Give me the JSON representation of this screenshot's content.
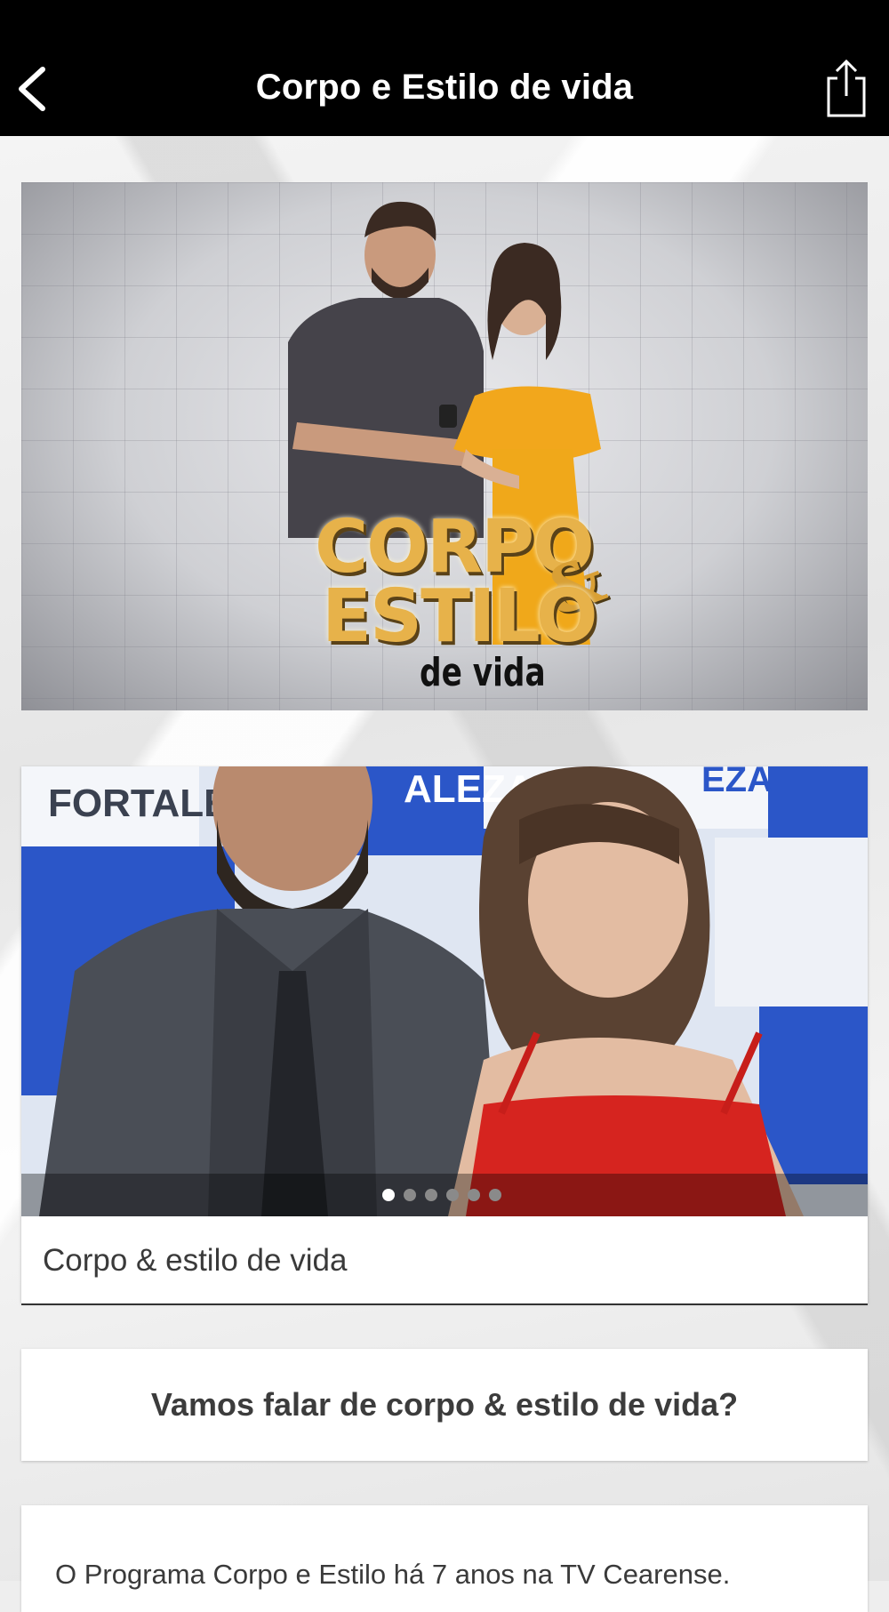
{
  "navbar": {
    "title": "Corpo e Estilo de vida",
    "back_icon": "chevron-left-icon",
    "share_icon": "share-icon"
  },
  "hero": {
    "logo_line1": "CORPO",
    "logo_amp": "&",
    "logo_line2": "ESTILO",
    "logo_line3": "de vida"
  },
  "slideshow": {
    "photo_text_left": "FORTALEZ",
    "photo_text_mid": "ALEZA",
    "photo_text_right": "EZA",
    "dots_total": 6,
    "active_index": 0,
    "caption": "Corpo & estilo de vida"
  },
  "heading_card": {
    "text": "Vamos falar de corpo & estilo de vida?"
  },
  "text_card": {
    "body": "O Programa Corpo e Estilo há 7 anos na TV Cearense."
  },
  "colors": {
    "navbar_bg": "#000000",
    "accent_gold": "#e7b24a"
  }
}
